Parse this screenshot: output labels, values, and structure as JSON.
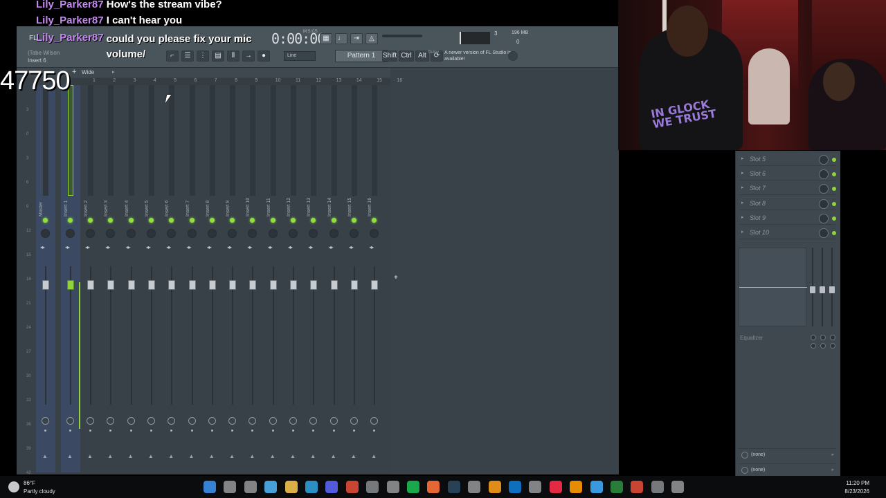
{
  "chat": [
    {
      "user": "Lily_Parker87",
      "message": "How's the stream vibe?"
    },
    {
      "user": "Lily_Parker87",
      "message": "I can't hear you"
    },
    {
      "user": "Lily_Parker87",
      "message": "could you please fix your mic volume/"
    }
  ],
  "counter": "47750",
  "fl": {
    "title": "FL",
    "user": "(Tabe Wilson",
    "insert": "Insert 6",
    "time": "0:00:00",
    "time_label": "M:S:CS",
    "line_select": "Line",
    "pattern": "Pattern 1",
    "shift": "Shift",
    "ctrl": "Ctrl",
    "alt": "Alt",
    "news_hint": "Today",
    "news": "A newer version of FL Studio is available!",
    "cpu": "3",
    "mem": "196 MB",
    "voices": "0"
  },
  "mixer": {
    "add": "+",
    "wide": "Wide",
    "ruler": [
      "1",
      "2",
      "3",
      "4",
      "5",
      "6",
      "7",
      "8",
      "9",
      "10",
      "11",
      "12",
      "13",
      "14",
      "15",
      "16"
    ],
    "db_scale": [
      "3",
      "0",
      "3",
      "6",
      "9",
      "12",
      "15",
      "18",
      "21",
      "24",
      "27",
      "30",
      "33",
      "36",
      "39",
      "42"
    ],
    "strips": [
      "Master",
      "Insert 1",
      "Insert 2",
      "Insert 3",
      "Insert 4",
      "Insert 5",
      "Insert 6",
      "Insert 7",
      "Insert 8",
      "Insert 9",
      "Insert 10",
      "Insert 11",
      "Insert 12",
      "Insert 13",
      "Insert 14",
      "Insert 15",
      "Insert 16"
    ],
    "selected_strip": "Insert 1",
    "led_color": "#8fe03b"
  },
  "fx_panel": {
    "slots": [
      "Slot 5",
      "Slot 6",
      "Slot 7",
      "Slot 8",
      "Slot 9",
      "Slot 10"
    ],
    "eq_label": "Equalizer",
    "route_in": "(none)",
    "route_out": "(none)"
  },
  "webcam": {
    "shirt_text": "IN GLOCK WE TRUST"
  },
  "taskbar": {
    "temp": "86°F",
    "weather": "Partly cloudy",
    "time": "11:20 PM",
    "date": "8/23/2026",
    "apps": [
      "windows-start",
      "search",
      "task-view",
      "copilot",
      "file-explorer",
      "edge",
      "discord",
      "chrome",
      "settings",
      "store",
      "spotify",
      "firefox",
      "steam",
      "fl-studio",
      "vs-code",
      "garageband",
      "ableton",
      "itunes",
      "illustrator",
      "app1",
      "app2",
      "chrome2",
      "settings2",
      "app3"
    ]
  }
}
